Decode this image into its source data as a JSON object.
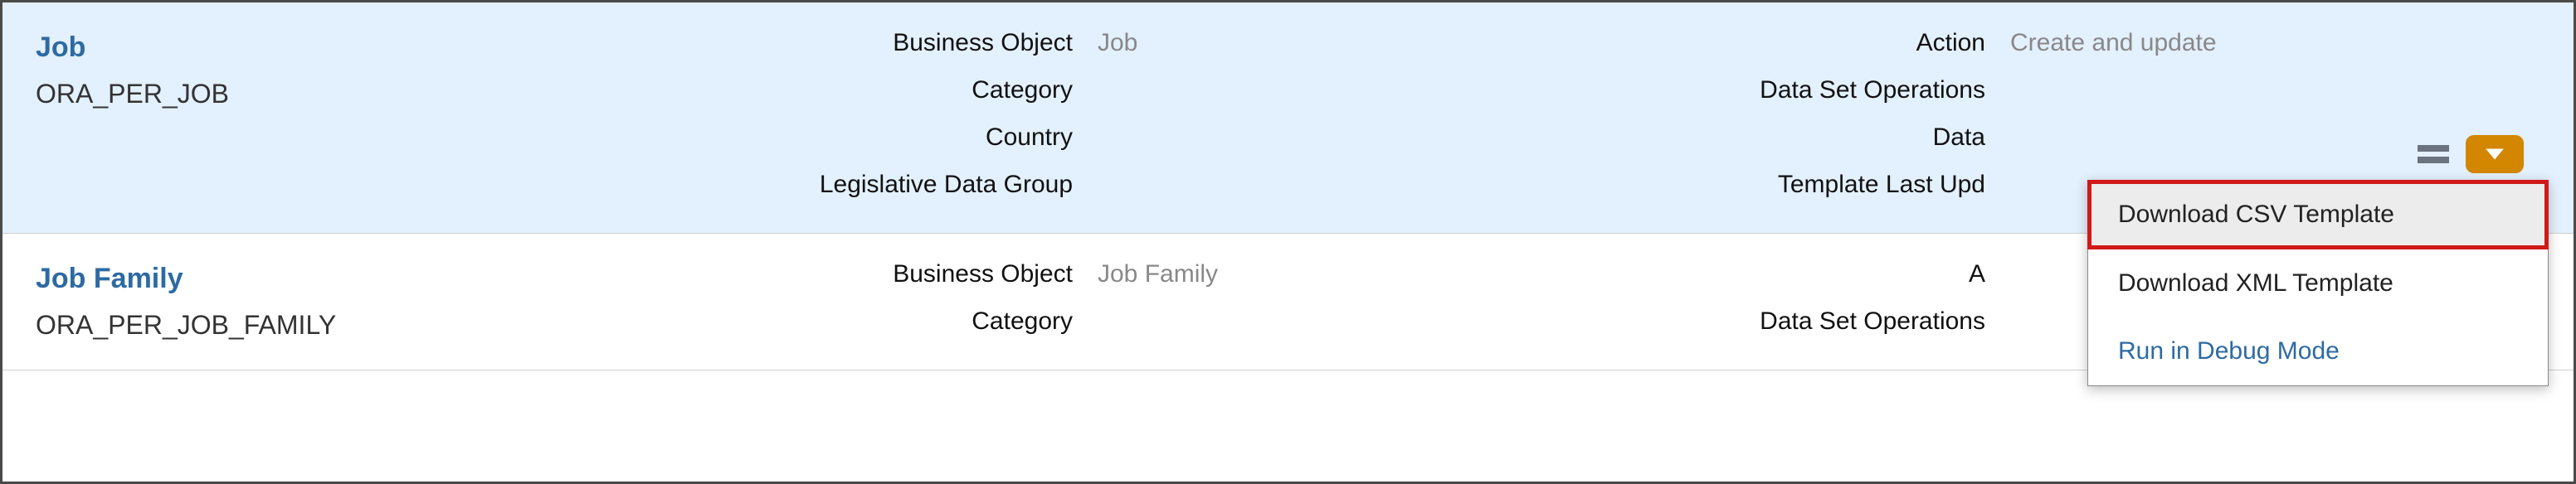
{
  "rows": [
    {
      "name": "Job",
      "code": "ORA_PER_JOB",
      "fields": {
        "business_object_label": "Business Object",
        "business_object_value": "Job",
        "category_label": "Category",
        "category_value": "",
        "country_label": "Country",
        "country_value": "",
        "ldg_label": "Legislative Data Group",
        "ldg_value": ""
      },
      "right": {
        "action_label": "Action",
        "action_value": "Create and update",
        "dso_label": "Data Set Operations",
        "dso_value": "",
        "data_label": "Data",
        "data_value": "",
        "tlu_label": "Template Last Upd",
        "tlu_value": ""
      }
    },
    {
      "name": "Job Family",
      "code": "ORA_PER_JOB_FAMILY",
      "fields": {
        "business_object_label": "Business Object",
        "business_object_value": "Job Family",
        "category_label": "Category",
        "category_value": ""
      },
      "right": {
        "action_label_short": "A",
        "action_value": "",
        "dso_label": "Data Set Operations",
        "dso_value": ""
      }
    }
  ],
  "menu": {
    "download_csv": "Download CSV Template",
    "download_xml": "Download XML Template",
    "run_debug": "Run in Debug Mode"
  }
}
